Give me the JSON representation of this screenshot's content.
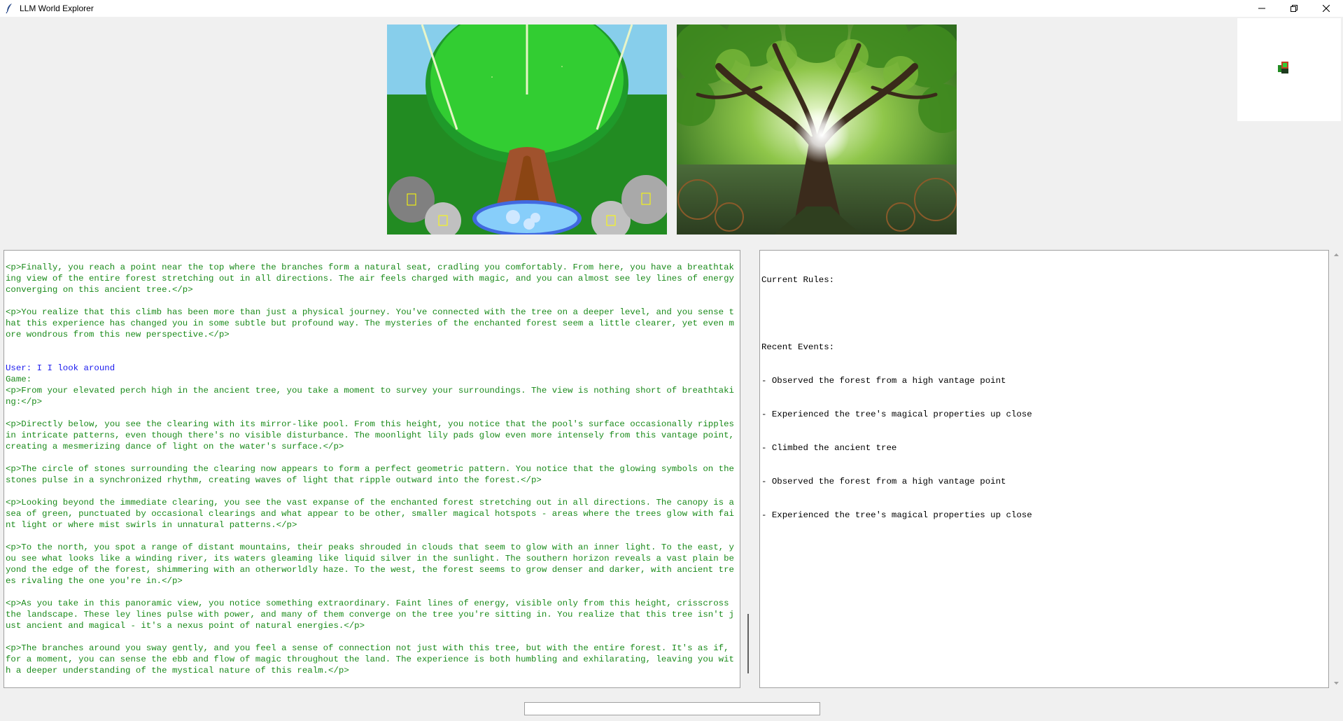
{
  "window": {
    "title": "LLM World Explorer"
  },
  "story": {
    "lines": [
      {
        "kind": "game",
        "text": "<p>Finally, you reach a point near the top where the branches form a natural seat, cradling you comfortably. From here, you have a breathtaking view of the entire forest stretching out in all directions. The air feels charged with magic, and you can almost see ley lines of energy converging on this ancient tree.</p>"
      },
      {
        "kind": "blank",
        "text": ""
      },
      {
        "kind": "game",
        "text": "<p>You realize that this climb has been more than just a physical journey. You've connected with the tree on a deeper level, and you sense that this experience has changed you in some subtle but profound way. The mysteries of the enchanted forest seem a little clearer, yet even more wondrous from this new perspective.</p>"
      },
      {
        "kind": "blank",
        "text": ""
      },
      {
        "kind": "blank",
        "text": ""
      },
      {
        "kind": "user",
        "text": "User: I I look around"
      },
      {
        "kind": "game",
        "text": "Game:"
      },
      {
        "kind": "game",
        "text": "<p>From your elevated perch high in the ancient tree, you take a moment to survey your surroundings. The view is nothing short of breathtaking:</p>"
      },
      {
        "kind": "blank",
        "text": ""
      },
      {
        "kind": "game",
        "text": "<p>Directly below, you see the clearing with its mirror-like pool. From this height, you notice that the pool's surface occasionally ripples in intricate patterns, even though there's no visible disturbance. The moonlight lily pads glow even more intensely from this vantage point, creating a mesmerizing dance of light on the water's surface.</p>"
      },
      {
        "kind": "blank",
        "text": ""
      },
      {
        "kind": "game",
        "text": "<p>The circle of stones surrounding the clearing now appears to form a perfect geometric pattern. You notice that the glowing symbols on the stones pulse in a synchronized rhythm, creating waves of light that ripple outward into the forest.</p>"
      },
      {
        "kind": "blank",
        "text": ""
      },
      {
        "kind": "game",
        "text": "<p>Looking beyond the immediate clearing, you see the vast expanse of the enchanted forest stretching out in all directions. The canopy is a sea of green, punctuated by occasional clearings and what appear to be other, smaller magical hotspots - areas where the trees glow with faint light or where mist swirls in unnatural patterns.</p>"
      },
      {
        "kind": "blank",
        "text": ""
      },
      {
        "kind": "game",
        "text": "<p>To the north, you spot a range of distant mountains, their peaks shrouded in clouds that seem to glow with an inner light. To the east, you see what looks like a winding river, its waters gleaming like liquid silver in the sunlight. The southern horizon reveals a vast plain beyond the edge of the forest, shimmering with an otherworldly haze. To the west, the forest seems to grow denser and darker, with ancient trees rivaling the one you're in.</p>"
      },
      {
        "kind": "blank",
        "text": ""
      },
      {
        "kind": "game",
        "text": "<p>As you take in this panoramic view, you notice something extraordinary. Faint lines of energy, visible only from this height, crisscross the landscape. These ley lines pulse with power, and many of them converge on the tree you're sitting in. You realize that this tree isn't just ancient and magical - it's a nexus point of natural energies.</p>"
      },
      {
        "kind": "blank",
        "text": ""
      },
      {
        "kind": "game",
        "text": "<p>The branches around you sway gently, and you feel a sense of connection not just with this tree, but with the entire forest. It's as if, for a moment, you can sense the ebb and flow of magic throughout the land. The experience is both humbling and exhilarating, leaving you with a deeper understanding of the mystical nature of this realm.</p>"
      }
    ]
  },
  "rules": {
    "header": "Current Rules:",
    "events_header": "Recent Events:",
    "events": [
      "- Observed the forest from a high vantage point",
      "- Experienced the tree's magical properties up close",
      "- Climbed the ancient tree",
      "- Observed the forest from a high vantage point",
      "- Experienced the tree's magical properties up close"
    ]
  },
  "command": {
    "value": ""
  },
  "colors": {
    "game_text": "#1a8a1a",
    "user_text": "#1a1aee"
  }
}
